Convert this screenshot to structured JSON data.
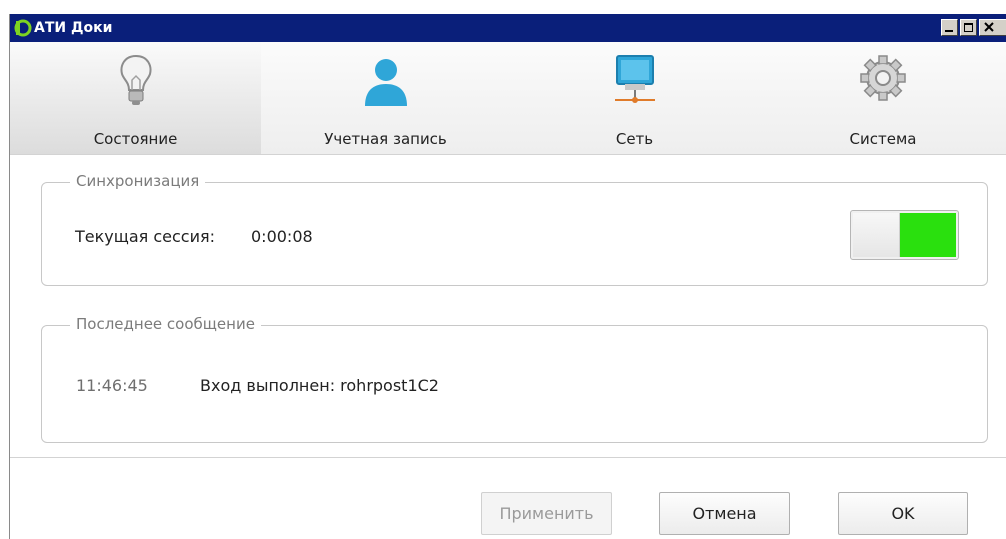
{
  "window": {
    "title": "АТИ Доки",
    "controls": [
      "minimize-icon",
      "maximize-icon",
      "close-icon"
    ]
  },
  "tabs": [
    {
      "label": "Состояние",
      "icon": "lightbulb-icon",
      "active": true
    },
    {
      "label": "Учетная запись",
      "icon": "user-icon",
      "active": false
    },
    {
      "label": "Сеть",
      "icon": "network-monitor-icon",
      "active": false
    },
    {
      "label": "Система",
      "icon": "gear-icon",
      "active": false
    }
  ],
  "sync": {
    "legend": "Синхронизация",
    "session_label": "Текущая сессия:",
    "session_value": "0:00:08",
    "toggle_on": true,
    "toggle_color": "#2ae00e"
  },
  "last_message": {
    "legend": "Последнее сообщение",
    "time": "11:46:45",
    "text": "Вход выполнен: rohrpost1C2"
  },
  "footer": {
    "apply_label": "Применить",
    "cancel_label": "Отмена",
    "ok_label": "OK"
  },
  "colors": {
    "titlebar": "#0a1f7a",
    "accent_green": "#2ae00e"
  }
}
